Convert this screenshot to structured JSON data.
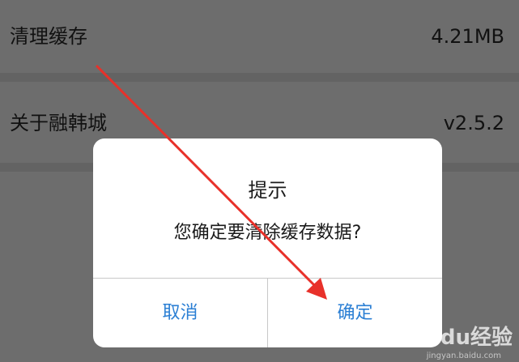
{
  "settings": {
    "cache": {
      "label": "清理缓存",
      "value": "4.21MB"
    },
    "about": {
      "label": "关于融韩城",
      "value": "v2.5.2"
    }
  },
  "dialog": {
    "title": "提示",
    "message": "您确定要清除缓存数据?",
    "cancel_label": "取消",
    "confirm_label": "确定"
  },
  "watermark": {
    "text": "Baidu经验",
    "sub": "jingyan.baidu.com"
  },
  "colors": {
    "overlay": "#6b6b6b",
    "dialog_bg": "#ffffff",
    "button_text": "#2b7fd4",
    "arrow": "#e8312a"
  }
}
